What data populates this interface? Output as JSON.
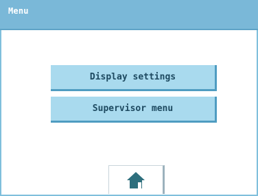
{
  "title_bar": {
    "title": "Menu"
  },
  "menu": {
    "items": [
      {
        "label": "Display settings"
      },
      {
        "label": "Supervisor menu"
      }
    ]
  },
  "footer": {
    "home_icon": "home-icon"
  },
  "colors": {
    "title_bar_bg": "#7ab8d8",
    "button_bg": "#a9daee",
    "button_shadow": "#4f9cc1",
    "button_text": "#1d4960",
    "home_icon": "#2e6f7d"
  }
}
